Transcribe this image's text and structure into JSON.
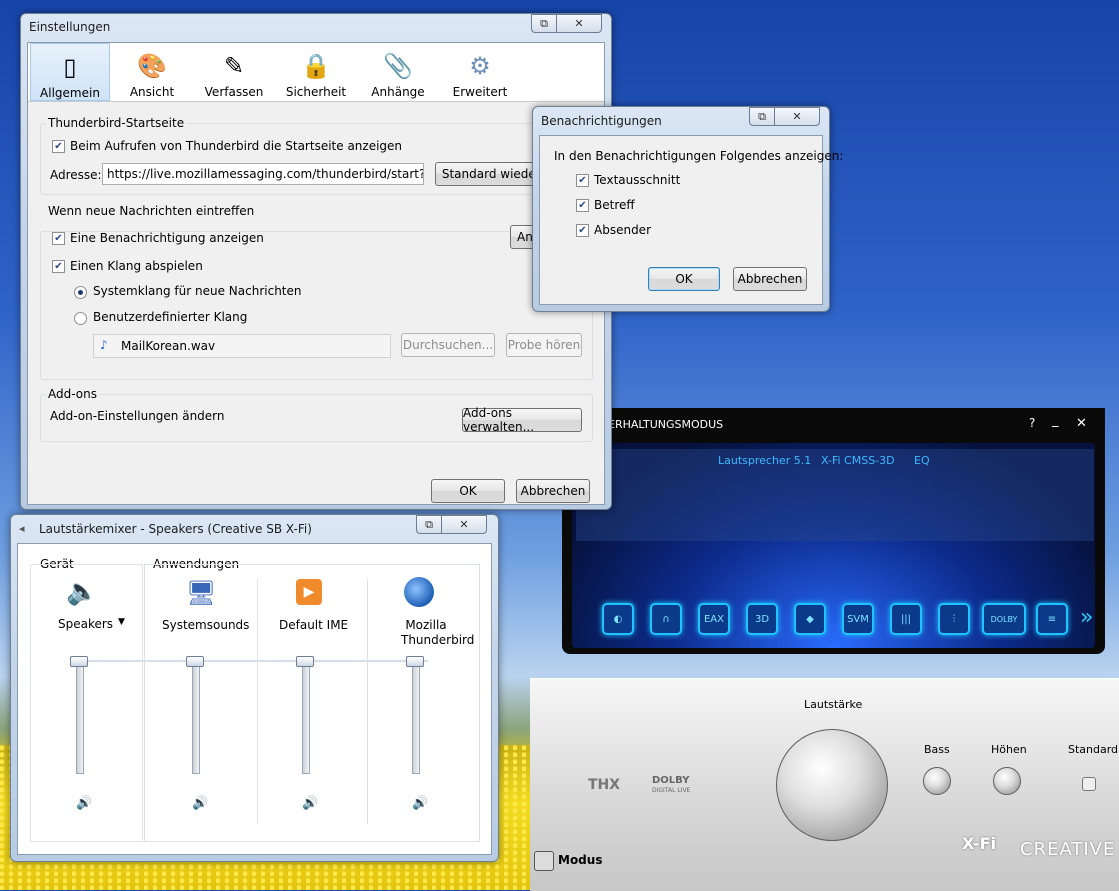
{
  "prefs": {
    "title": "Einstellungen",
    "toolbar": [
      {
        "label": "Allgemein",
        "icon": "general-icon",
        "selected": true
      },
      {
        "label": "Ansicht",
        "icon": "display-icon"
      },
      {
        "label": "Verfassen",
        "icon": "compose-icon"
      },
      {
        "label": "Sicherheit",
        "icon": "lock-icon"
      },
      {
        "label": "Anhänge",
        "icon": "paperclip-icon"
      },
      {
        "label": "Erweitert",
        "icon": "gear-icon"
      }
    ],
    "startpage": {
      "group_title": "Thunderbird-Startseite",
      "show_checkbox": "Beim Aufrufen von Thunderbird die Startseite anzeigen",
      "address_label": "Adresse:",
      "address_value": "https://live.mozillamessaging.com/thunderbird/start?locale",
      "restore_button": "Standard wiederh"
    },
    "newmail": {
      "group_title": "Wenn neue Nachrichten eintreffen",
      "notify_checkbox": "Eine Benachrichtigung anzeigen",
      "notify_button": "An",
      "sound_checkbox": "Einen Klang abspielen",
      "system_sound": "Systemklang für neue Nachrichten",
      "custom_sound": "Benutzerdefinierter Klang",
      "sound_file": "MailKorean.wav",
      "browse_button": "Durchsuchen...",
      "test_button": "Probe hören"
    },
    "addons": {
      "group_title": "Add-ons",
      "label": "Add-on-Einstellungen ändern",
      "manage_button": "Add-ons verwalten..."
    },
    "ok": "OK",
    "cancel": "Abbrechen"
  },
  "notify": {
    "title": "Benachrichtigungen",
    "heading": "In den Benachrichtigungen Folgendes anzeigen:",
    "options": [
      "Textausschnitt",
      "Betreff",
      "Absender"
    ],
    "ok": "OK",
    "cancel": "Abbrechen"
  },
  "mixer": {
    "title": "Lautstärkemixer - Speakers (Creative SB X-Fi)",
    "device_heading": "Gerät",
    "apps_heading": "Anwendungen",
    "channels": [
      {
        "name": "Speakers",
        "icon": "speaker-device-icon"
      },
      {
        "name": "Systemsounds",
        "icon": "system-sounds-icon"
      },
      {
        "name": "Default IME",
        "icon": "ime-icon"
      },
      {
        "name": "Mozilla Thunderbird",
        "icon": "thunderbird-icon"
      }
    ]
  },
  "creative": {
    "mode_title": "ERHALTUNGSMODUS",
    "help": "?",
    "minimize": "_",
    "close": "✕",
    "tabs": [
      "Lautsprecher 5.1",
      "X-Fi CMSS-3D",
      "EQ"
    ],
    "icons": [
      "SVM",
      "3D",
      "EAX",
      "DOLBY"
    ],
    "volume_label": "Lautstärke",
    "bass_label": "Bass",
    "treble_label": "Höhen",
    "standard_label": "Standard",
    "thx": "THX",
    "dolby": "DOLBY",
    "dolby_sub": "DIGITAL LIVE",
    "mode_button": "Modus",
    "brand": "CREATIVE",
    "xfi": "X-Fi"
  }
}
